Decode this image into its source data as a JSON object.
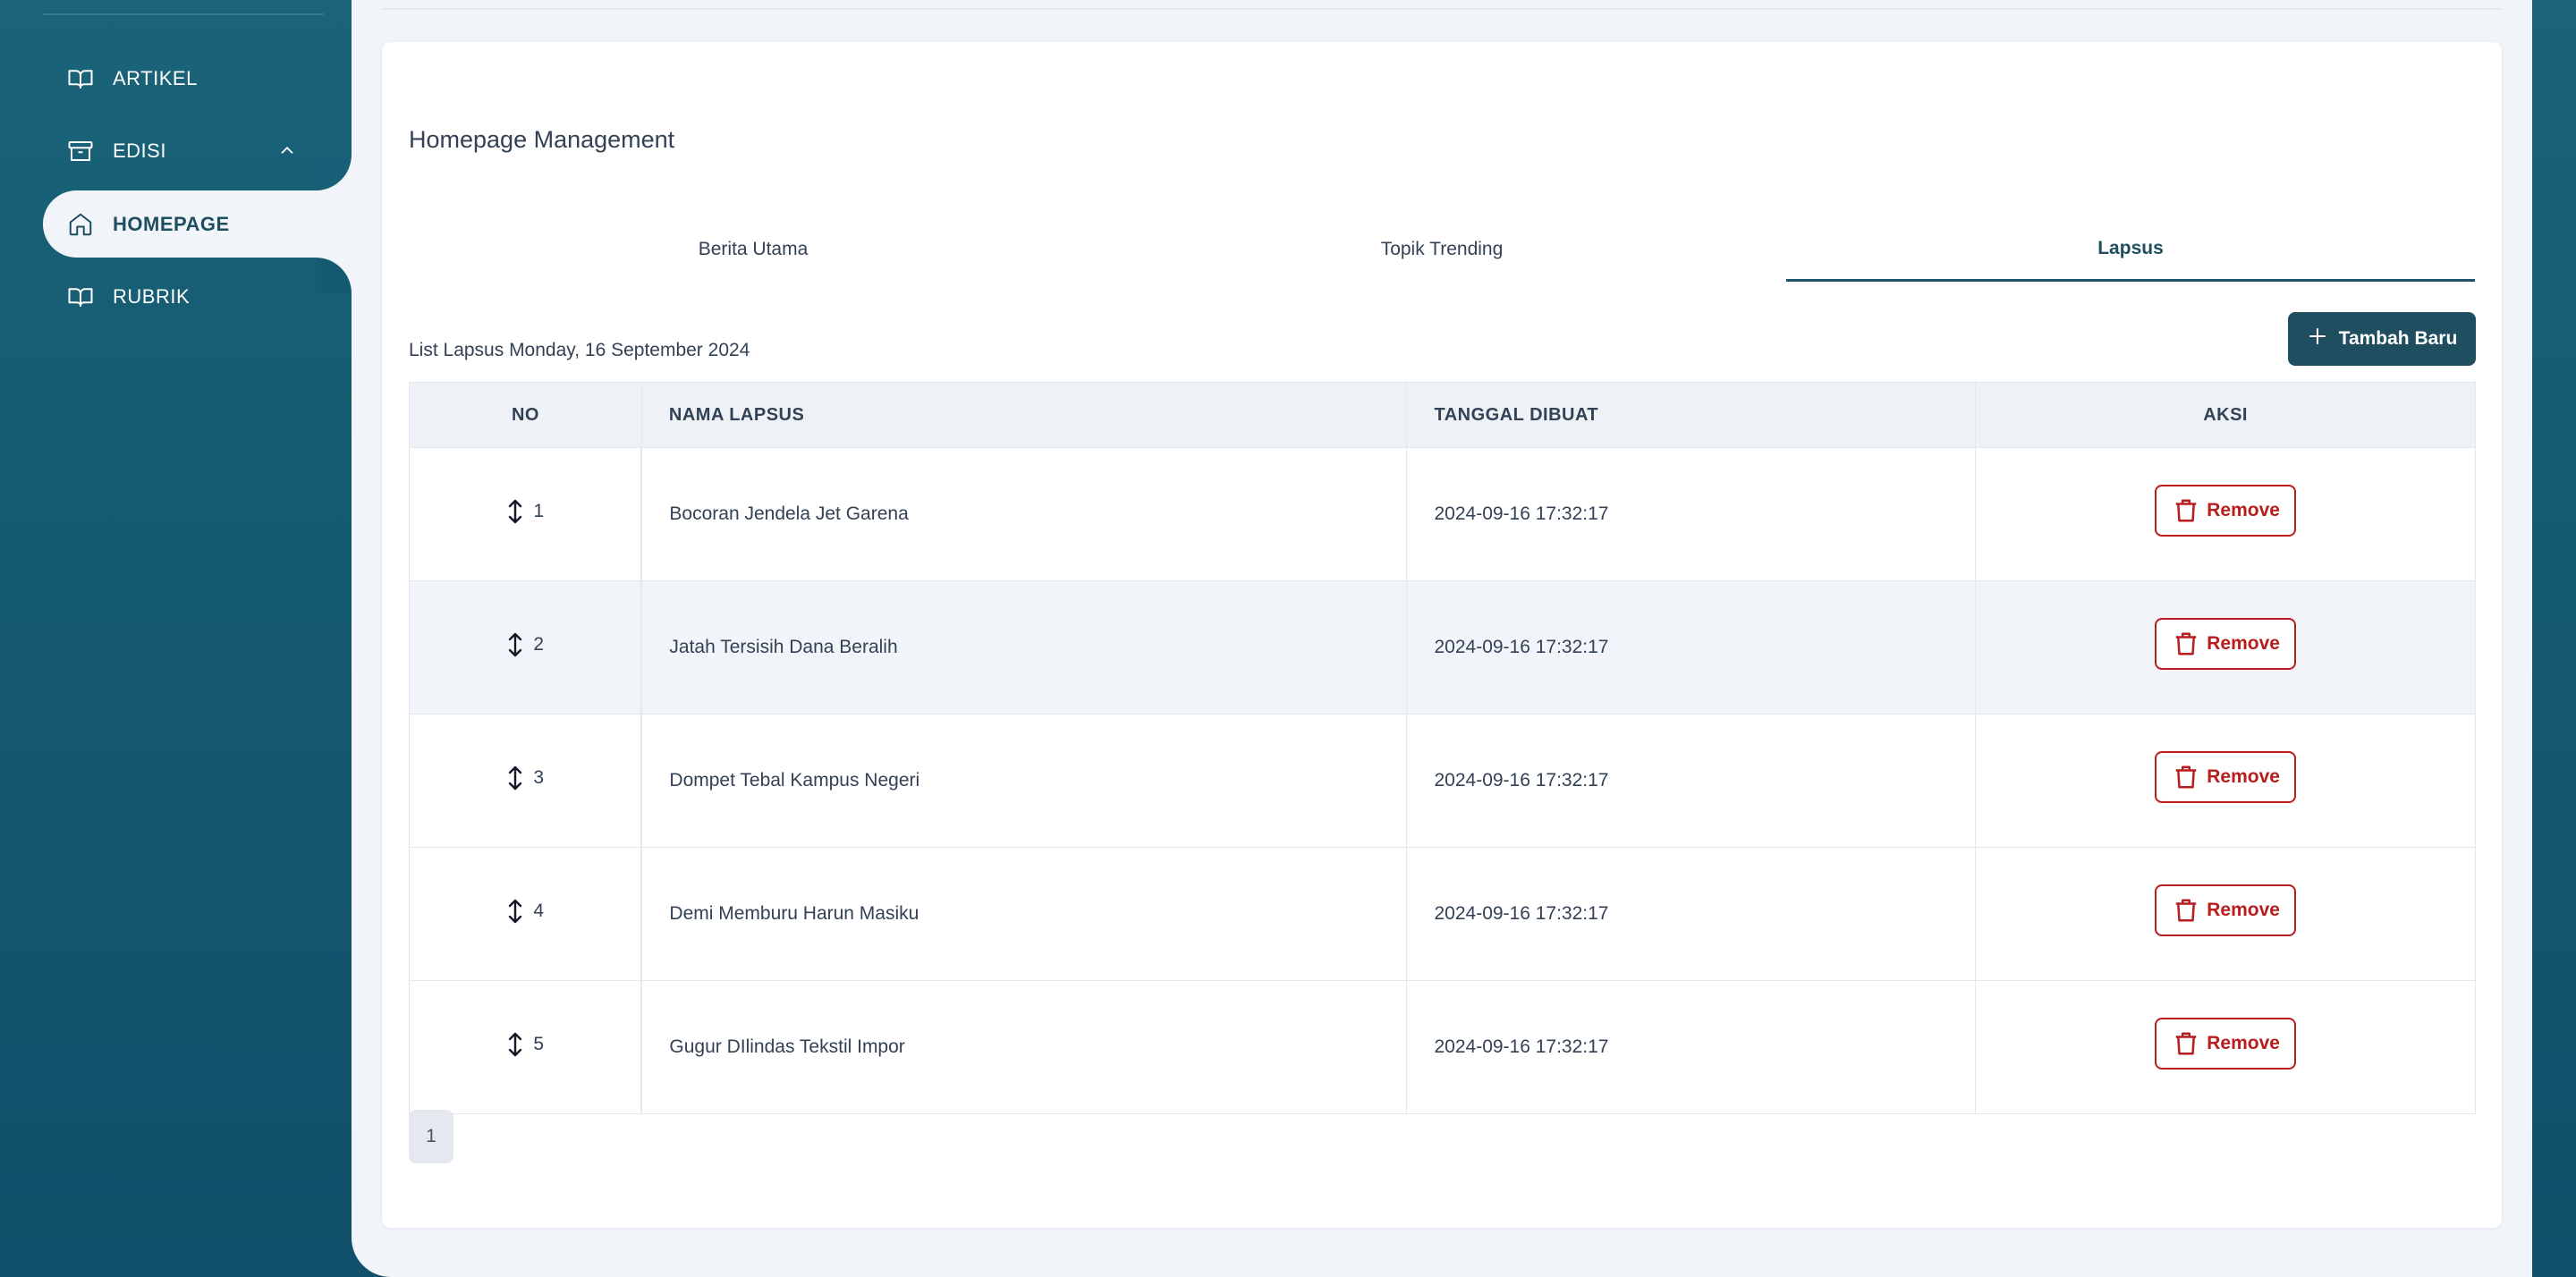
{
  "sidebar": {
    "items": [
      {
        "label": "ARTIKEL",
        "icon": "book-open-icon"
      },
      {
        "label": "EDISI",
        "icon": "archive-icon"
      },
      {
        "label": "HOMEPAGE",
        "icon": "home-icon"
      },
      {
        "label": "RUBRIK",
        "icon": "book-open-icon"
      }
    ],
    "active": "HOMEPAGE"
  },
  "page": {
    "title": "Homepage Management",
    "tabs": [
      {
        "label": "Berita Utama"
      },
      {
        "label": "Topik Trending"
      },
      {
        "label": "Lapsus"
      }
    ],
    "active_tab": "Lapsus",
    "list_title": "List Lapsus Monday, 16 September 2024",
    "add_button": "Tambah Baru"
  },
  "table": {
    "headers": {
      "no": "NO",
      "nama": "NAMA LAPSUS",
      "tanggal": "TANGGAL DIBUAT",
      "aksi": "AKSI"
    },
    "remove_label": "Remove",
    "rows": [
      {
        "no": "1",
        "nama": "Bocoran Jendela Jet Garena",
        "tanggal": "2024-09-16 17:32:17"
      },
      {
        "no": "2",
        "nama": "Jatah Tersisih Dana Beralih",
        "tanggal": "2024-09-16 17:32:17"
      },
      {
        "no": "3",
        "nama": "Dompet Tebal Kampus Negeri",
        "tanggal": "2024-09-16 17:32:17"
      },
      {
        "no": "4",
        "nama": "Demi Memburu Harun Masiku",
        "tanggal": "2024-09-16 17:32:17"
      },
      {
        "no": "5",
        "nama": "Gugur DIlindas Tekstil Impor",
        "tanggal": "2024-09-16 17:32:17"
      }
    ]
  },
  "pagination": {
    "current": "1"
  },
  "colors": {
    "sidebar": "#145a70",
    "primary": "#1e4e5f",
    "danger": "#b91c1c",
    "background": "#f1f5f9"
  }
}
